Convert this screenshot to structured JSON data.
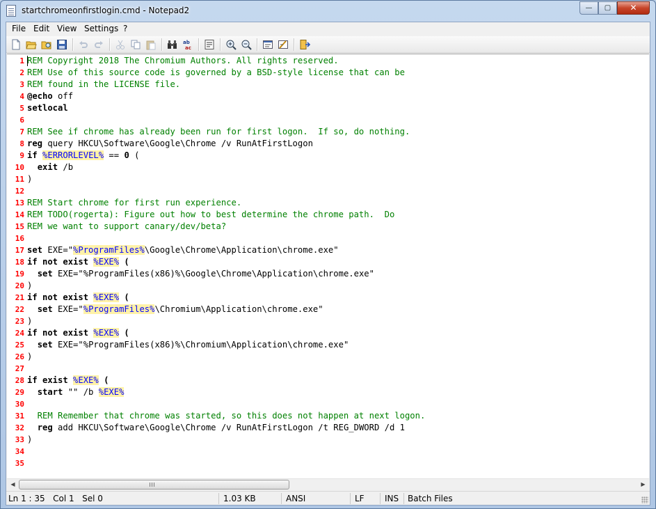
{
  "window": {
    "title": "startchromeonfirstlogin.cmd - Notepad2",
    "controls": {
      "minimize": "—",
      "maximize": "▢",
      "close": "✕"
    }
  },
  "menu": [
    "File",
    "Edit",
    "View",
    "Settings",
    "?"
  ],
  "toolbar": [
    {
      "name": "new-file-icon"
    },
    {
      "name": "open-folder-icon"
    },
    {
      "name": "browse-icon"
    },
    {
      "name": "save-icon"
    },
    {
      "name": "undo-icon"
    },
    {
      "name": "redo-icon"
    },
    {
      "name": "cut-icon"
    },
    {
      "name": "copy-icon"
    },
    {
      "name": "paste-icon"
    },
    {
      "name": "find-icon"
    },
    {
      "name": "replace-icon"
    },
    {
      "name": "word-wrap-icon"
    },
    {
      "name": "zoom-in-icon"
    },
    {
      "name": "zoom-out-icon"
    },
    {
      "name": "scheme-icon"
    },
    {
      "name": "customize-scheme-icon"
    },
    {
      "name": "exit-icon"
    }
  ],
  "editor": {
    "line_numbers": [
      "1",
      "2",
      "3",
      "4",
      "5",
      "6",
      "7",
      "8",
      "9",
      "10",
      "11",
      "12",
      "13",
      "14",
      "15",
      "16",
      "17",
      "18",
      "19",
      "20",
      "21",
      "22",
      "23",
      "24",
      "25",
      "26",
      "27",
      "28",
      "29",
      "30",
      "31",
      "32",
      "33",
      "34",
      "35"
    ],
    "lines": [
      [
        {
          "t": "REM Copyright 2018 The Chromium Authors. All rights reserved.",
          "c": "rem"
        }
      ],
      [
        {
          "t": "REM Use of this source code is governed by a BSD-style license that can be",
          "c": "rem"
        }
      ],
      [
        {
          "t": "REM found in the LICENSE file.",
          "c": "rem"
        }
      ],
      [
        {
          "t": "@echo",
          "c": "kw"
        },
        {
          "t": " off",
          "c": ""
        }
      ],
      [
        {
          "t": "setlocal",
          "c": "kw"
        }
      ],
      [],
      [
        {
          "t": "REM See if chrome has already been run for first logon.  If so, do nothing.",
          "c": "rem"
        }
      ],
      [
        {
          "t": "reg",
          "c": "kw"
        },
        {
          "t": " query HKCU\\Software\\Google\\Chrome /v RunAtFirstLogon",
          "c": ""
        }
      ],
      [
        {
          "t": "if",
          "c": "kw"
        },
        {
          "t": " ",
          "c": ""
        },
        {
          "t": "%ERRORLEVEL%",
          "c": "var"
        },
        {
          "t": " == ",
          "c": ""
        },
        {
          "t": "0",
          "c": "kw"
        },
        {
          "t": " (",
          "c": ""
        }
      ],
      [
        {
          "t": "  ",
          "c": ""
        },
        {
          "t": "exit",
          "c": "kw"
        },
        {
          "t": " /b",
          "c": ""
        }
      ],
      [
        {
          "t": ")",
          "c": ""
        }
      ],
      [],
      [
        {
          "t": "REM Start chrome for first run experience.",
          "c": "rem"
        }
      ],
      [
        {
          "t": "REM TODO(rogerta): Figure out how to best determine the chrome path.  Do",
          "c": "rem"
        }
      ],
      [
        {
          "t": "REM we want to support canary/dev/beta?",
          "c": "rem"
        }
      ],
      [],
      [
        {
          "t": "set",
          "c": "kw"
        },
        {
          "t": " EXE=\"",
          "c": ""
        },
        {
          "t": "%ProgramFiles%",
          "c": "var"
        },
        {
          "t": "\\Google\\Chrome\\Application\\chrome.exe\"",
          "c": ""
        }
      ],
      [
        {
          "t": "if not exist",
          "c": "kw"
        },
        {
          "t": " ",
          "c": ""
        },
        {
          "t": "%EXE%",
          "c": "var"
        },
        {
          "t": " (",
          "c": "kw"
        }
      ],
      [
        {
          "t": "  ",
          "c": ""
        },
        {
          "t": "set",
          "c": "kw"
        },
        {
          "t": " EXE=\"%ProgramFiles(x86)%\\Google\\Chrome\\Application\\chrome.exe\"",
          "c": ""
        }
      ],
      [
        {
          "t": ")",
          "c": ""
        }
      ],
      [
        {
          "t": "if not exist",
          "c": "kw"
        },
        {
          "t": " ",
          "c": ""
        },
        {
          "t": "%EXE%",
          "c": "var"
        },
        {
          "t": " (",
          "c": "kw"
        }
      ],
      [
        {
          "t": "  ",
          "c": ""
        },
        {
          "t": "set",
          "c": "kw"
        },
        {
          "t": " EXE=\"",
          "c": ""
        },
        {
          "t": "%ProgramFiles%",
          "c": "var"
        },
        {
          "t": "\\Chromium\\Application\\chrome.exe\"",
          "c": ""
        }
      ],
      [
        {
          "t": ")",
          "c": ""
        }
      ],
      [
        {
          "t": "if not exist",
          "c": "kw"
        },
        {
          "t": " ",
          "c": ""
        },
        {
          "t": "%EXE%",
          "c": "var"
        },
        {
          "t": " (",
          "c": "kw"
        }
      ],
      [
        {
          "t": "  ",
          "c": ""
        },
        {
          "t": "set",
          "c": "kw"
        },
        {
          "t": " EXE=\"%ProgramFiles(x86)%\\Chromium\\Application\\chrome.exe\"",
          "c": ""
        }
      ],
      [
        {
          "t": ")",
          "c": ""
        }
      ],
      [],
      [
        {
          "t": "if exist",
          "c": "kw"
        },
        {
          "t": " ",
          "c": ""
        },
        {
          "t": "%EXE%",
          "c": "var"
        },
        {
          "t": " (",
          "c": "kw"
        }
      ],
      [
        {
          "t": "  ",
          "c": ""
        },
        {
          "t": "start",
          "c": "kw"
        },
        {
          "t": " \"\" /b ",
          "c": ""
        },
        {
          "t": "%EXE%",
          "c": "var"
        }
      ],
      [],
      [
        {
          "t": "  REM Remember that chrome was started, so this does not happen at next logon.",
          "c": "rem"
        }
      ],
      [
        {
          "t": "  ",
          "c": ""
        },
        {
          "t": "reg",
          "c": "kw"
        },
        {
          "t": " add HKCU\\Software\\Google\\Chrome /v RunAtFirstLogon /t REG_DWORD /d 1",
          "c": ""
        }
      ],
      [
        {
          "t": ")",
          "c": ""
        }
      ],
      [],
      []
    ]
  },
  "statusbar": {
    "position": "Ln 1 : 35   Col 1   Sel 0",
    "size": "1.03 KB",
    "encoding": "ANSI",
    "eol": "LF",
    "mode": "INS",
    "scheme": "Batch Files"
  },
  "colors": {
    "comment": "#008000",
    "line_number": "#ff0000",
    "variable_highlight": "#fff2a8",
    "variable_text": "#0000ff"
  }
}
